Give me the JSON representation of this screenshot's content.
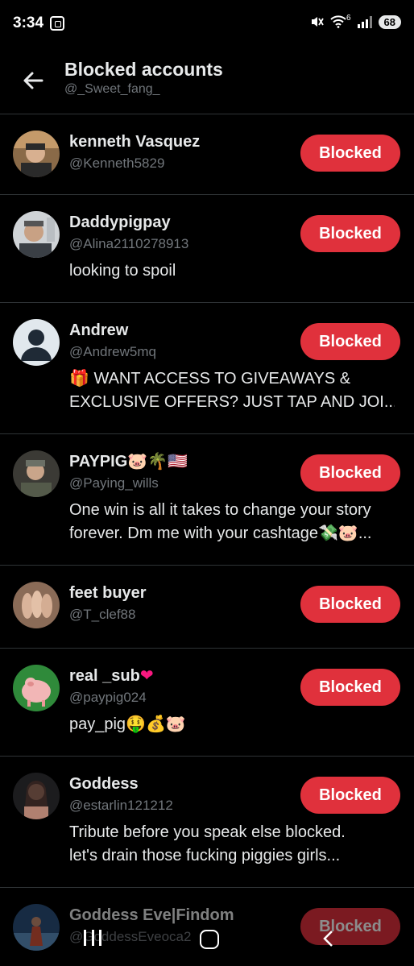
{
  "status_bar": {
    "time": "3:34",
    "battery": "68",
    "network": "6"
  },
  "header": {
    "title": "Blocked accounts",
    "subtitle": "@_Sweet_fang_"
  },
  "button_label": "Blocked",
  "accounts": [
    {
      "name": "kenneth Vasquez",
      "handle": "@Kenneth5829",
      "bio": []
    },
    {
      "name": "Daddypigpay",
      "handle": "@Alina2110278913",
      "bio": [
        "looking to spoil"
      ]
    },
    {
      "name": "Andrew",
      "handle": "@Andrew5mq",
      "bio": [
        "🎁 WANT ACCESS TO GIVEAWAYS &",
        "EXCLUSIVE OFFERS? JUST TAP AND JOI..."
      ]
    },
    {
      "name": "PAYPIG🐷🌴🇺🇸",
      "handle": "@Paying_wills",
      "bio": [
        "One win is all it takes to change your story",
        "forever. Dm me with your cashtage💸🐷..."
      ]
    },
    {
      "name": "feet buyer",
      "handle": "@T_clef88",
      "bio": []
    },
    {
      "name": "real _sub",
      "name_suffix": "❤",
      "handle": "@paypig024",
      "bio": [
        "pay_pig🤑💰🐷"
      ]
    },
    {
      "name": "Goddess",
      "handle": "@estarlin121212",
      "bio": [
        "Tribute before you speak else blocked.",
        "let's drain those fucking piggies girls..."
      ]
    },
    {
      "name": "Goddess Eve|Findom",
      "handle": "@GoddessEveoca2",
      "bio": []
    }
  ],
  "colors": {
    "background": "#000000",
    "blocked_button": "#e0313c",
    "secondary_text": "#71767b",
    "divider": "#2f3336"
  }
}
